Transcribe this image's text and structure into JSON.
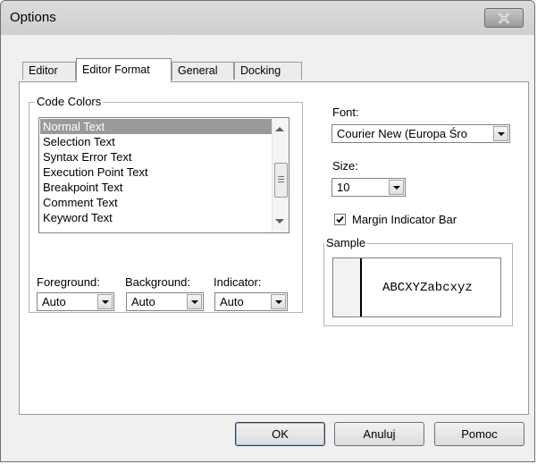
{
  "window": {
    "title": "Options"
  },
  "tabs": [
    {
      "label": "Editor",
      "active": false
    },
    {
      "label": "Editor Format",
      "active": true
    },
    {
      "label": "General",
      "active": false
    },
    {
      "label": "Docking",
      "active": false
    }
  ],
  "code_colors": {
    "label": "Code Colors",
    "items": [
      "Normal Text",
      "Selection Text",
      "Syntax Error Text",
      "Execution Point Text",
      "Breakpoint Text",
      "Comment Text",
      "Keyword Text"
    ],
    "selected_index": 0,
    "foreground": {
      "label": "Foreground:",
      "value": "Auto"
    },
    "background": {
      "label": "Background:",
      "value": "Auto"
    },
    "indicator": {
      "label": "Indicator:",
      "value": "Auto"
    }
  },
  "font": {
    "label": "Font:",
    "value": "Courier New (Europa Śro"
  },
  "size": {
    "label": "Size:",
    "value": "10"
  },
  "margin_indicator": {
    "label": "Margin Indicator Bar",
    "checked": true
  },
  "sample": {
    "label": "Sample",
    "text": "ABCXYZabcxyz"
  },
  "buttons": {
    "ok": "OK",
    "cancel": "Anuluj",
    "help": "Pomoc"
  },
  "icons": {
    "close": "close-icon",
    "dropdown": "chevron-down-icon",
    "check": "check-icon"
  }
}
